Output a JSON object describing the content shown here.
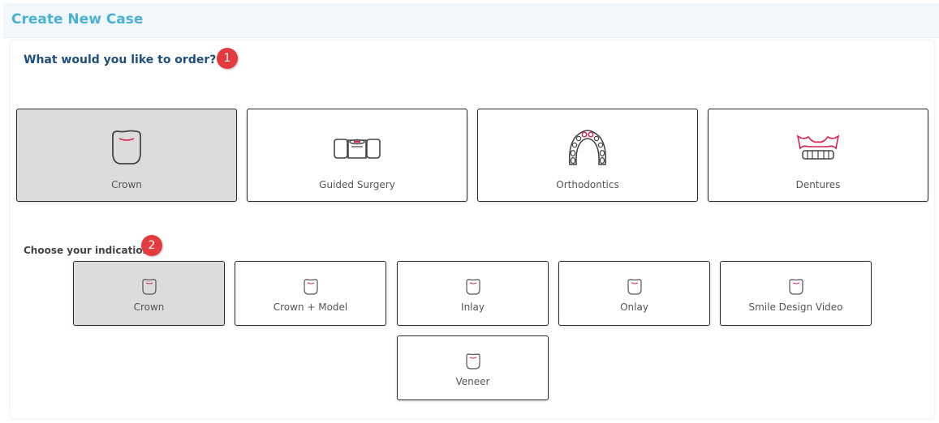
{
  "header": {
    "title": "Create New Case"
  },
  "order_section": {
    "question": "What would you like to order?",
    "step_badge": "1",
    "options": [
      {
        "label": "Crown",
        "icon": "crown-tooth-icon",
        "selected": true
      },
      {
        "label": "Guided Surgery",
        "icon": "guided-surgery-icon",
        "selected": false
      },
      {
        "label": "Orthodontics",
        "icon": "orthodontics-arch-icon",
        "selected": false
      },
      {
        "label": "Dentures",
        "icon": "dentures-icon",
        "selected": false
      }
    ]
  },
  "indication_section": {
    "question": "Choose your indication",
    "step_badge": "2",
    "options": [
      {
        "label": "Crown",
        "icon": "tooth-icon",
        "selected": true
      },
      {
        "label": "Crown + Model",
        "icon": "tooth-icon",
        "selected": false
      },
      {
        "label": "Inlay",
        "icon": "tooth-icon",
        "selected": false
      },
      {
        "label": "Onlay",
        "icon": "tooth-icon",
        "selected": false
      },
      {
        "label": "Smile Design Video",
        "icon": "tooth-icon",
        "selected": false
      },
      {
        "label": "Veneer",
        "icon": "tooth-icon",
        "selected": false
      }
    ]
  },
  "colors": {
    "header_title": "#4ab1d6",
    "question": "#1d4e7d",
    "badge": "#e53a3e",
    "selected_bg": "#dcdcdc",
    "icon_accent": "#d6204f"
  }
}
